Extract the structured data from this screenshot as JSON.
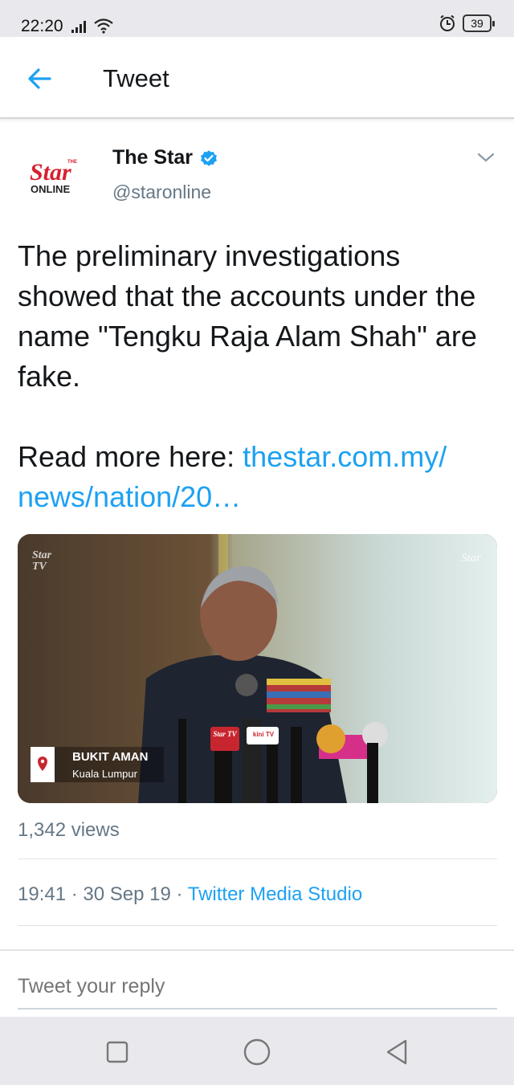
{
  "status_bar": {
    "time": "22:20",
    "battery": "39",
    "icons": [
      "signal-icon",
      "wifi-icon",
      "alarm-icon",
      "battery-icon"
    ]
  },
  "header": {
    "title": "Tweet",
    "back_icon": "back-arrow-icon"
  },
  "tweet": {
    "author": {
      "name": "The Star",
      "handle": "@staronline",
      "verified": true,
      "avatar_logo": {
        "top": "THE",
        "main": "Star",
        "bottom": "ONLINE"
      }
    },
    "text": "The preliminary investigations showed that the accounts under the name \"Tengku Raja Alam Shah\" are fake.",
    "read_more_prefix": "Read more here: ",
    "link": "thestar.com.my/ news/nation/20…",
    "media": {
      "watermark": "Star TV",
      "watermark_right": "Star",
      "location_title": "BUKIT AMAN",
      "location_subtitle": "Kuala Lumpur",
      "mic_label_1": "Star TV",
      "mic_label_2": "kini TV"
    },
    "views": "1,342 views",
    "time": "19:41",
    "date": "30 Sep 19",
    "source": "Twitter Media Studio",
    "separator": " · "
  },
  "reply": {
    "placeholder": "Tweet your reply"
  },
  "colors": {
    "link_blue": "#1da1f2",
    "secondary_text": "#657786",
    "star_red": "#d6202e",
    "verified_blue": "#1da1f2"
  }
}
